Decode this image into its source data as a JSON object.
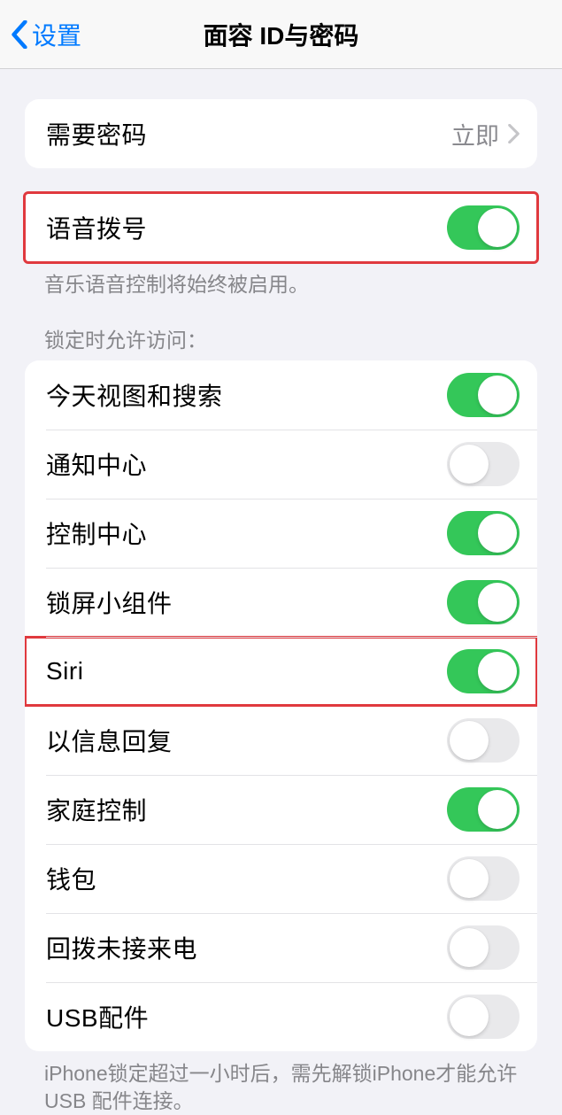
{
  "nav": {
    "back_label": "设置",
    "title": "面容 ID与密码"
  },
  "passcode_row": {
    "label": "需要密码",
    "value": "立即"
  },
  "voice_dial": {
    "label": "语音拨号",
    "footer": "音乐语音控制将始终被启用。",
    "on": true
  },
  "locked_section": {
    "header": "锁定时允许访问：",
    "footer": "iPhone锁定超过一小时后，需先解锁iPhone才能允许USB 配件连接。",
    "items": [
      {
        "label": "今天视图和搜索",
        "on": true,
        "highlight": false
      },
      {
        "label": "通知中心",
        "on": false,
        "highlight": false
      },
      {
        "label": "控制中心",
        "on": true,
        "highlight": false
      },
      {
        "label": "锁屏小组件",
        "on": true,
        "highlight": false
      },
      {
        "label": "Siri",
        "on": true,
        "highlight": true
      },
      {
        "label": "以信息回复",
        "on": false,
        "highlight": false
      },
      {
        "label": "家庭控制",
        "on": true,
        "highlight": false
      },
      {
        "label": "钱包",
        "on": false,
        "highlight": false
      },
      {
        "label": "回拨未接来电",
        "on": false,
        "highlight": false
      },
      {
        "label": "USB配件",
        "on": false,
        "highlight": false
      }
    ]
  }
}
